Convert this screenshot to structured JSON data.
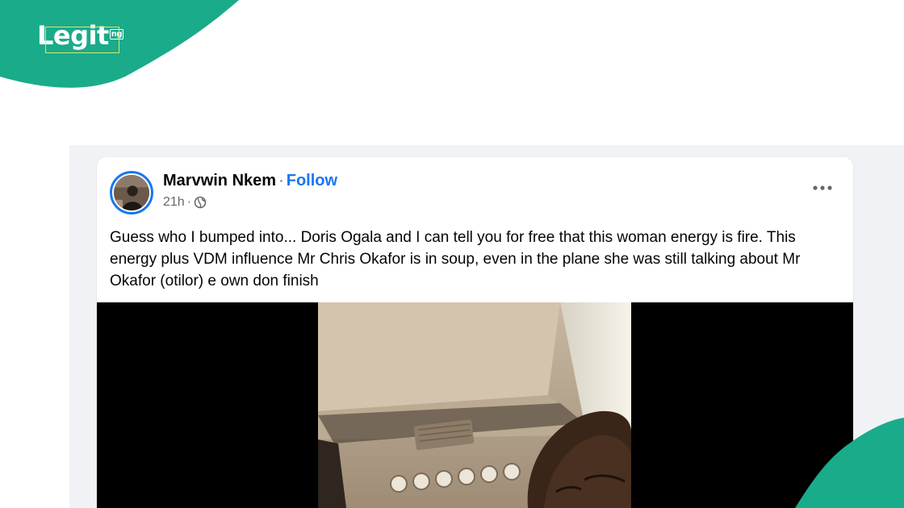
{
  "brand": {
    "logo_text": "Legit",
    "logo_tld": "ng",
    "accent_color": "#1aab8a"
  },
  "post": {
    "author": "Marvwin Nkem",
    "separator": "·",
    "follow_label": "Follow",
    "time": "21h",
    "meta_separator": "·",
    "privacy_icon": "globe-icon",
    "more_icon": "more-options-icon",
    "text": "Guess who I bumped into... Doris Ogala and I can tell you for free that this woman energy is fire. This energy plus VDM influence Mr Chris Okafor is in soup, even in the plane she was still talking about Mr Okafor (otilor) e own don finish"
  },
  "colors": {
    "link": "#1877f2",
    "feed_background": "#f0f2f5",
    "text_primary": "#050505",
    "text_secondary": "#65676b"
  }
}
